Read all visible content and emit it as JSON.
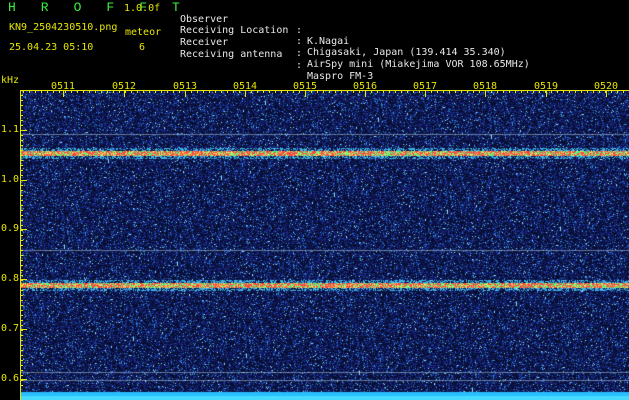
{
  "header": {
    "app_title": "H R O F F T",
    "version": "1.0.0f",
    "filename": "KN9_2504230510.png",
    "meteor_label": "meteor",
    "meteor_count": "6",
    "timestamp": "25.04.23 05:10"
  },
  "station": [
    {
      "label": "Observer",
      "value": "K.Nagai"
    },
    {
      "label": "Receiving Location",
      "value": "Chigasaki, Japan (139.414 35.340)"
    },
    {
      "label": "Receiver",
      "value": "AirSpy mini (Miakejima VOR 108.65MHz)"
    },
    {
      "label": "Receiving antenna",
      "value": "Maspro FM-3"
    }
  ],
  "axis": {
    "unit": "kHz",
    "y_ticks": [
      "1.1",
      "1.0",
      "0.9",
      "0.8",
      "0.7",
      "0.6"
    ],
    "x_ticks": [
      "0511",
      "0512",
      "0513",
      "0514",
      "0515",
      "0516",
      "0517",
      "0518",
      "0519",
      "0520"
    ]
  },
  "colors": {
    "text_yellow": "#e6e600",
    "title_green": "#3cf03c",
    "background": "#000000",
    "noise_blue": "#16207a",
    "trace_red": "#ff4040",
    "trace_green": "#40ff80",
    "floor_cyan": "#38c8ff"
  }
}
